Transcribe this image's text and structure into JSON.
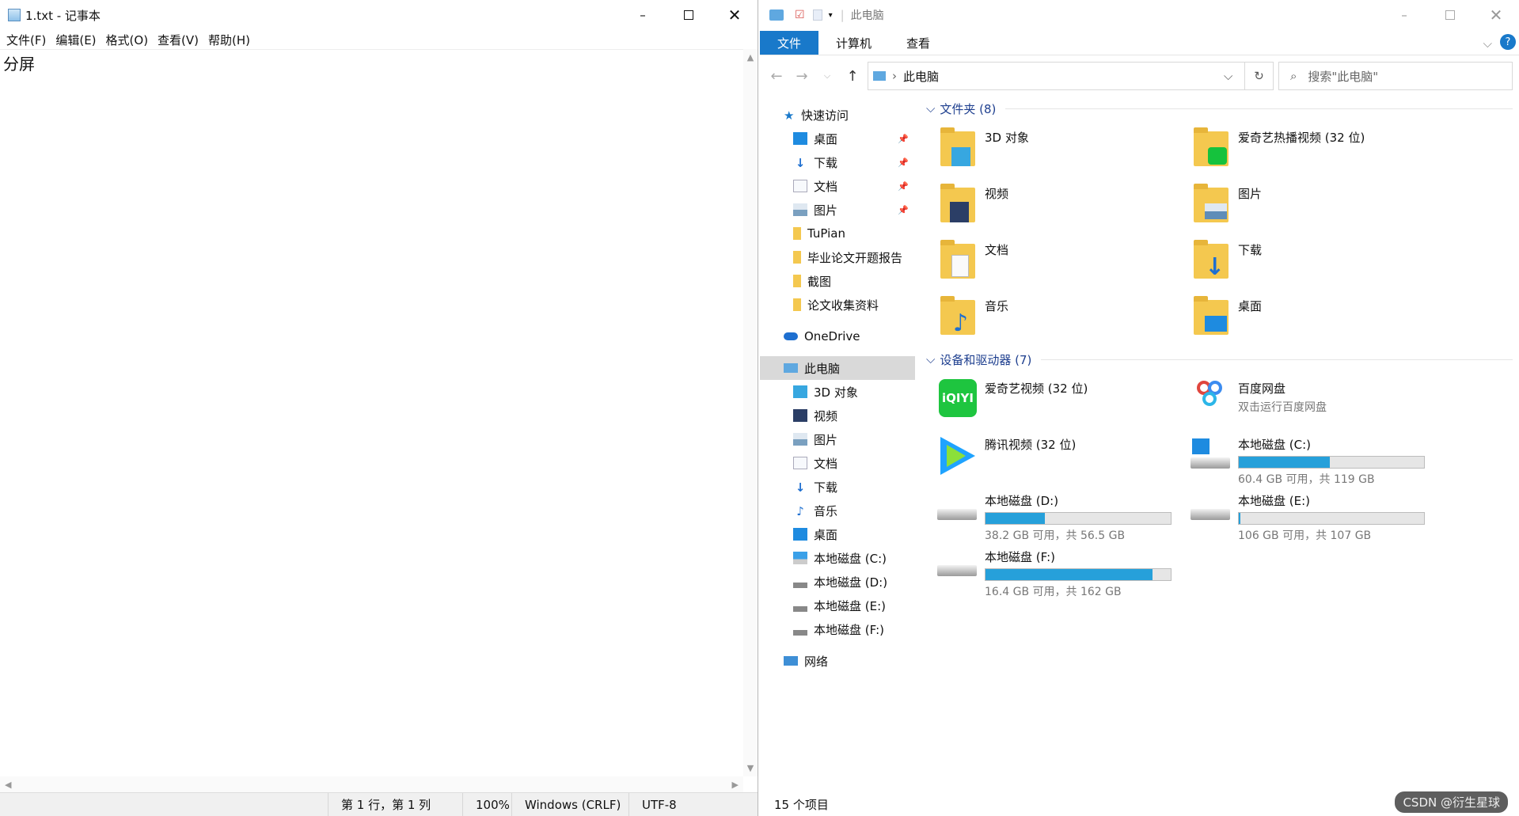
{
  "notepad": {
    "title": "1.txt - 记事本",
    "menu": [
      "文件(F)",
      "编辑(E)",
      "格式(O)",
      "查看(V)",
      "帮助(H)"
    ],
    "content": "分屏",
    "status": {
      "position": "第 1 行，第 1 列",
      "zoom": "100%",
      "line_ending": "Windows (CRLF)",
      "encoding": "UTF-8"
    }
  },
  "explorer": {
    "title": "此电脑",
    "ribbon_tabs": [
      "文件",
      "计算机",
      "查看"
    ],
    "address": "此电脑",
    "search_placeholder": "搜索\"此电脑\"",
    "nav": {
      "quick_access": "快速访问",
      "quick_items": [
        "桌面",
        "下载",
        "文档",
        "图片",
        "TuPian",
        "毕业论文开题报告",
        "截图",
        "论文收集资料"
      ],
      "onedrive": "OneDrive",
      "this_pc": "此电脑",
      "pc_items": [
        "3D 对象",
        "视频",
        "图片",
        "文档",
        "下载",
        "音乐",
        "桌面",
        "本地磁盘 (C:)",
        "本地磁盘 (D:)",
        "本地磁盘 (E:)",
        "本地磁盘 (F:)"
      ],
      "network": "网络"
    },
    "folders_header": "文件夹 (8)",
    "folders": [
      "3D 对象",
      "爱奇艺热播视频 (32 位)",
      "视频",
      "图片",
      "文档",
      "下载",
      "音乐",
      "桌面"
    ],
    "devices_header": "设备和驱动器 (7)",
    "apps": [
      {
        "name": "爱奇艺视频 (32 位)"
      },
      {
        "name": "百度网盘",
        "sub": "双击运行百度网盘"
      },
      {
        "name": "腾讯视频 (32 位)"
      }
    ],
    "drives": [
      {
        "name": "本地磁盘 (C:)",
        "free": "60.4 GB 可用，共 119 GB",
        "used_fraction": 0.49
      },
      {
        "name": "本地磁盘 (D:)",
        "free": "38.2 GB 可用，共 56.5 GB",
        "used_fraction": 0.32
      },
      {
        "name": "本地磁盘 (E:)",
        "free": "106 GB 可用，共 107 GB",
        "used_fraction": 0.01
      },
      {
        "name": "本地磁盘 (F:)",
        "free": "16.4 GB 可用，共 162 GB",
        "used_fraction": 0.9
      }
    ],
    "status": "15 个项目"
  },
  "watermark": "CSDN @衍生星球",
  "colors": {
    "accent": "#1979ca",
    "drive_fill": "#26a0da",
    "folder": "#f4c84f"
  }
}
